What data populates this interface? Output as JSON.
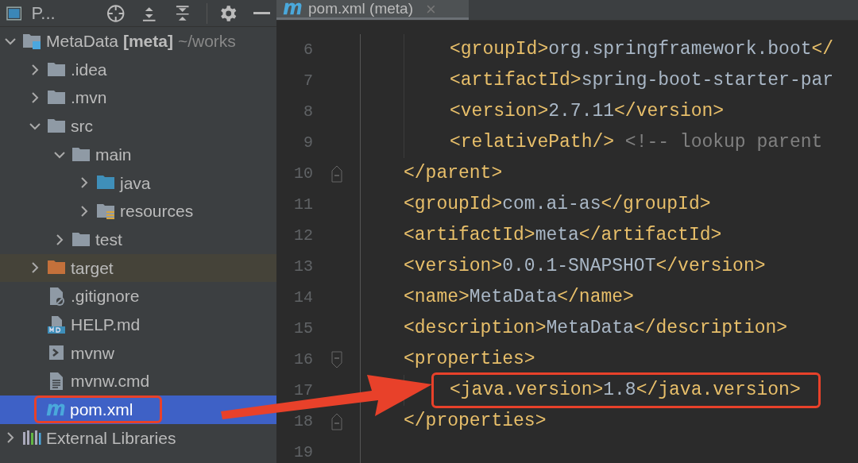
{
  "project_panel": {
    "title": "P...",
    "tree": [
      {
        "name": "MetaData **[meta]**",
        "path": "~/works",
        "kind": "module",
        "expanded": true,
        "selected": false,
        "boxed": false,
        "children": [
          {
            "name": ".idea",
            "kind": "folder",
            "expanded": false,
            "selected": false,
            "boxed": false
          },
          {
            "name": ".mvn",
            "kind": "folder",
            "expanded": false,
            "selected": false,
            "boxed": false
          },
          {
            "name": "src",
            "kind": "folder",
            "expanded": true,
            "selected": false,
            "boxed": false,
            "children": [
              {
                "name": "main",
                "kind": "folder",
                "expanded": true,
                "selected": false,
                "boxed": false,
                "children": [
                  {
                    "name": "java",
                    "kind": "source",
                    "expanded": false,
                    "selected": false,
                    "boxed": false
                  },
                  {
                    "name": "resources",
                    "kind": "resources",
                    "expanded": false,
                    "selected": false,
                    "boxed": false
                  }
                ]
              },
              {
                "name": "test",
                "kind": "folder",
                "expanded": false,
                "selected": false,
                "boxed": false
              }
            ]
          },
          {
            "name": "target",
            "kind": "excluded",
            "expanded": false,
            "selected": false,
            "boxed": false
          },
          {
            "name": ".gitignore",
            "kind": "ignore",
            "selected": false,
            "boxed": false
          },
          {
            "name": "HELP.md",
            "kind": "markdown",
            "selected": false,
            "boxed": false
          },
          {
            "name": "mvnw",
            "kind": "shell",
            "selected": false,
            "boxed": false
          },
          {
            "name": "mvnw.cmd",
            "kind": "text",
            "selected": false,
            "boxed": false
          },
          {
            "name": "pom.xml",
            "kind": "maven",
            "selected": true,
            "boxed": true
          }
        ]
      },
      {
        "name": "External Libraries",
        "kind": "libraries",
        "expanded": false,
        "selected": false,
        "boxed": false
      }
    ]
  },
  "editor": {
    "tab": {
      "title": "pom.xml (meta)",
      "close": "×"
    },
    "lines": [
      {
        "number": "6",
        "indented": true,
        "guide": true,
        "fold_open": false,
        "fold_close": false,
        "boxed": false,
        "segments": [
          {
            "kind": "tag",
            "text": "<groupId>"
          },
          {
            "kind": "text",
            "text": "org.springframework.boot"
          },
          {
            "kind": "tag",
            "text": "</"
          }
        ]
      },
      {
        "number": "7",
        "indented": true,
        "guide": true,
        "fold_open": false,
        "fold_close": false,
        "boxed": false,
        "segments": [
          {
            "kind": "tag",
            "text": "<artifactId>"
          },
          {
            "kind": "text",
            "text": "spring-boot-starter-par"
          }
        ]
      },
      {
        "number": "8",
        "indented": true,
        "guide": true,
        "fold_open": false,
        "fold_close": false,
        "boxed": false,
        "segments": [
          {
            "kind": "tag",
            "text": "<version>"
          },
          {
            "kind": "text",
            "text": "2.7.11"
          },
          {
            "kind": "tag",
            "text": "</version>"
          }
        ]
      },
      {
        "number": "9",
        "indented": true,
        "guide": true,
        "fold_open": false,
        "fold_close": false,
        "boxed": false,
        "segments": [
          {
            "kind": "tag",
            "text": "<relativePath/>"
          },
          {
            "kind": "comment",
            "text": " <!-- lookup parent"
          }
        ]
      },
      {
        "number": "10",
        "indented": false,
        "guide": false,
        "fold_open": false,
        "fold_close": true,
        "boxed": false,
        "segments": [
          {
            "kind": "tag",
            "text": "</parent>"
          }
        ]
      },
      {
        "number": "11",
        "indented": false,
        "guide": false,
        "fold_open": false,
        "fold_close": false,
        "boxed": false,
        "segments": [
          {
            "kind": "tag",
            "text": "<groupId>"
          },
          {
            "kind": "text",
            "text": "com.ai-as"
          },
          {
            "kind": "tag",
            "text": "</groupId>"
          }
        ]
      },
      {
        "number": "12",
        "indented": false,
        "guide": false,
        "fold_open": false,
        "fold_close": false,
        "boxed": false,
        "segments": [
          {
            "kind": "tag",
            "text": "<artifactId>"
          },
          {
            "kind": "text",
            "text": "meta"
          },
          {
            "kind": "tag",
            "text": "</artifactId>"
          }
        ]
      },
      {
        "number": "13",
        "indented": false,
        "guide": false,
        "fold_open": false,
        "fold_close": false,
        "boxed": false,
        "segments": [
          {
            "kind": "tag",
            "text": "<version>"
          },
          {
            "kind": "text",
            "text": "0.0.1-SNAPSHOT"
          },
          {
            "kind": "tag",
            "text": "</version>"
          }
        ]
      },
      {
        "number": "14",
        "indented": false,
        "guide": false,
        "fold_open": false,
        "fold_close": false,
        "boxed": false,
        "segments": [
          {
            "kind": "tag",
            "text": "<name>"
          },
          {
            "kind": "text",
            "text": "MetaData"
          },
          {
            "kind": "tag",
            "text": "</name>"
          }
        ]
      },
      {
        "number": "15",
        "indented": false,
        "guide": false,
        "fold_open": false,
        "fold_close": false,
        "boxed": false,
        "segments": [
          {
            "kind": "tag",
            "text": "<description>"
          },
          {
            "kind": "text",
            "text": "MetaData"
          },
          {
            "kind": "tag",
            "text": "</description>"
          }
        ]
      },
      {
        "number": "16",
        "indented": false,
        "guide": false,
        "fold_open": true,
        "fold_close": false,
        "boxed": false,
        "segments": [
          {
            "kind": "tag",
            "text": "<properties>"
          }
        ]
      },
      {
        "number": "17",
        "indented": true,
        "guide": true,
        "fold_open": false,
        "fold_close": false,
        "boxed": true,
        "segments": [
          {
            "kind": "tag",
            "text": "<java.version>"
          },
          {
            "kind": "text",
            "text": "1.8"
          },
          {
            "kind": "tag",
            "text": "</java.version>"
          }
        ]
      },
      {
        "number": "18",
        "indented": false,
        "guide": false,
        "fold_open": false,
        "fold_close": true,
        "boxed": false,
        "segments": [
          {
            "kind": "tag",
            "text": "</properties>"
          }
        ]
      },
      {
        "number": "19",
        "indented": false,
        "guide": false,
        "fold_open": false,
        "fold_close": false,
        "boxed": false
      }
    ]
  }
}
